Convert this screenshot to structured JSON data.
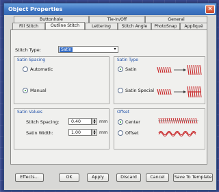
{
  "dialog": {
    "title": "Object Properties",
    "close_glyph": "×"
  },
  "tabs_row1": [
    {
      "label": "Buttonhole"
    },
    {
      "label": "Tie-In/Off"
    },
    {
      "label": "General"
    }
  ],
  "tabs_row2": [
    {
      "label": "Fill Stitch"
    },
    {
      "label": "Outline Stitch",
      "active": true
    },
    {
      "label": "Lettering"
    },
    {
      "label": "Stitch Angle"
    },
    {
      "label": "PhotoSnap"
    },
    {
      "label": "Appliqué"
    }
  ],
  "stitch_type": {
    "label": "Stitch Type:",
    "value": "Satin",
    "arrow_glyph": "▾"
  },
  "satin_spacing": {
    "title": "Satin Spacing",
    "options": [
      {
        "label": "Automatic",
        "checked": false
      },
      {
        "label": "Manual",
        "checked": true
      }
    ]
  },
  "satin_type": {
    "title": "Satin Type",
    "options": [
      {
        "label": "Satin",
        "checked": true
      },
      {
        "label": "Satin Special",
        "checked": false
      }
    ]
  },
  "satin_values": {
    "title": "Satin Values",
    "fields": [
      {
        "label": "Stitch Spacing:",
        "value": "0.40",
        "unit": "mm"
      },
      {
        "label": "Satin Width:",
        "value": "1.00",
        "unit": "mm"
      }
    ]
  },
  "offset": {
    "title": "Offset",
    "options": [
      {
        "label": "Center",
        "checked": true
      },
      {
        "label": "Offset",
        "checked": false
      }
    ]
  },
  "buttons": {
    "effects": "Effects...",
    "ok": "OK",
    "apply": "Apply",
    "discard": "Discard",
    "cancel": "Cancel",
    "save_template": "Save To Template"
  },
  "colors": {
    "stitch_red": "#c8282a",
    "accent_blue": "#316ac5"
  }
}
